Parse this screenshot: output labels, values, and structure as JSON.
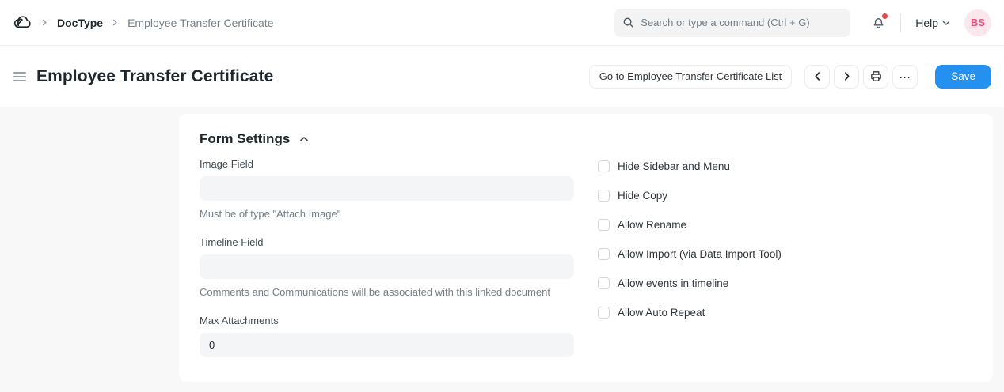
{
  "navbar": {
    "breadcrumb": {
      "app": "DocType",
      "page": "Employee Transfer Certificate"
    },
    "search": {
      "placeholder": "Search or type a command (Ctrl + G)"
    },
    "help_label": "Help",
    "avatar_initials": "BS",
    "icons": [
      "cloud-logo",
      "search-icon",
      "bell-icon",
      "chevron-down-icon"
    ]
  },
  "page_header": {
    "title": "Employee Transfer Certificate",
    "go_to_list_label": "Go to Employee Transfer Certificate List",
    "save_label": "Save",
    "ellipsis_label": "...",
    "icons": [
      "menu-icon",
      "chevron-left-icon",
      "chevron-right-icon",
      "printer-icon"
    ]
  },
  "form_settings": {
    "section_title": "Form Settings",
    "collapsed": false,
    "fields": [
      {
        "label": "Image Field",
        "value": "",
        "help": "Must be of type \"Attach Image\""
      },
      {
        "label": "Timeline Field",
        "value": "",
        "help": "Comments and Communications will be associated with this linked document"
      },
      {
        "label": "Max Attachments",
        "value": "0",
        "help": ""
      }
    ],
    "checkboxes": [
      {
        "label": "Hide Sidebar and Menu",
        "checked": false
      },
      {
        "label": "Hide Copy",
        "checked": false
      },
      {
        "label": "Allow Rename",
        "checked": false
      },
      {
        "label": "Allow Import (via Data Import Tool)",
        "checked": false
      },
      {
        "label": "Allow events in timeline",
        "checked": false
      },
      {
        "label": "Allow Auto Repeat",
        "checked": false
      }
    ]
  },
  "colors": {
    "primary_blue": "#2490ef",
    "notification_red": "#e24c4c",
    "avatar_bg": "#fce7ed",
    "avatar_text": "#e8537f",
    "input_bg": "#f4f5f6",
    "muted_text": "#74808b",
    "heading_text": "#1f272e",
    "page_bg": "#f8f8f8"
  }
}
